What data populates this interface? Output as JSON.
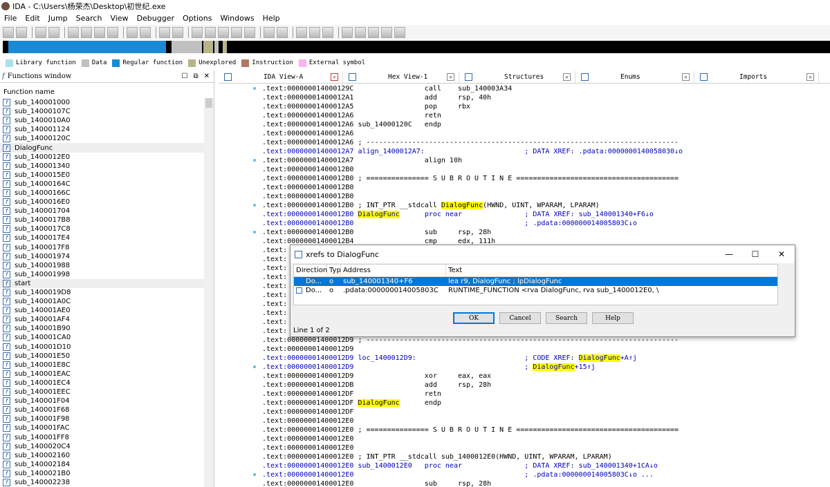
{
  "window": {
    "title": "IDA - C:\\Users\\杨荣杰\\Desktop\\初世纪.exe"
  },
  "menu": [
    "File",
    "Edit",
    "Jump",
    "Search",
    "View",
    "Debugger",
    "Options",
    "Windows",
    "Help"
  ],
  "legend": [
    {
      "label": "Library function",
      "color": "#aee0ec"
    },
    {
      "label": "Data",
      "color": "#c0c0c0"
    },
    {
      "label": "Regular function",
      "color": "#1a8ad6"
    },
    {
      "label": "Unexplored",
      "color": "#b8b48a"
    },
    {
      "label": "Instruction",
      "color": "#b07860"
    },
    {
      "label": "External symbol",
      "color": "#ffb0f0"
    }
  ],
  "functions_window": {
    "title": "Functions window",
    "column": "Function name",
    "items": [
      "sub_140001000",
      "sub_14000107C",
      "sub_1400010A0",
      "sub_140001124",
      "sub_14000120C",
      "DialogFunc",
      "sub_1400012E0",
      "sub_140001340",
      "sub_1400015E0",
      "sub_14000164C",
      "sub_14000166C",
      "sub_1400016E0",
      "sub_140001704",
      "sub_1400017B8",
      "sub_1400017C8",
      "sub_1400017E4",
      "sub_1400017F8",
      "sub_140001974",
      "sub_140001988",
      "sub_140001998",
      "start",
      "sub_1400019D8",
      "sub_140001A0C",
      "sub_140001AE0",
      "sub_140001AF4",
      "sub_140001B90",
      "sub_140001CA0",
      "sub_140001D10",
      "sub_140001E50",
      "sub_140001E8C",
      "sub_140001EAC",
      "sub_140001EC4",
      "sub_140001EEC",
      "sub_140001F04",
      "sub_140001F68",
      "sub_140001F98",
      "sub_140001FAC",
      "sub_140001FF8",
      "sub_1400020C4",
      "sub_140002160",
      "sub_140002184",
      "sub_1400021B0",
      "sub_140002238"
    ]
  },
  "tabs": [
    "IDA View-A",
    "Hex View-1",
    "Structures",
    "Enums",
    "Imports"
  ],
  "code_lines": [
    ".text:000000014000129C                 call    sub_140003A34",
    ".text:00000001400012A1                 add     rsp, 40h",
    ".text:00000001400012A5                 pop     rbx",
    ".text:00000001400012A6                 retn",
    ".text:00000001400012A6 sub_14000120C   endp",
    ".text:00000001400012A6",
    ".text:00000001400012A6 ; ---------------------------------------------------------------------------",
    ".text:00000001400012A7 align_1400012A7:                        ; DATA XREF: .pdata:0000000140058030↓o",
    ".text:00000001400012A7                 align 10h",
    ".text:00000001400012B0",
    ".text:00000001400012B0 ; =============== S U B R O U T I N E =======================================",
    ".text:00000001400012B0",
    ".text:00000001400012B0",
    ".text:00000001400012B0 ; INT_PTR __stdcall DialogFunc(HWND, UINT, WPARAM, LPARAM)",
    ".text:00000001400012B0 DialogFunc      proc near               ; DATA XREF: sub_140001340+F6↓o",
    ".text:00000001400012B0                                         ; .pdata:000000014005803C↓o",
    ".text:00000001400012B0                 sub     rsp, 28h",
    ".text:00000001400012B4                 cmp     edx, 111h",
    ".text:",
    ".text:",
    ".text:",
    ".text:",
    ".text:",
    ".text:",
    ".text:",
    ".text:",
    ".text:",
    ".text:",
    ".text:00000001400012D9 ; ---------------------------------------------------------------------------",
    ".text:00000001400012D9",
    ".text:00000001400012D9 loc_1400012D9:                          ; CODE XREF: DialogFunc+A↑j",
    ".text:00000001400012D9                                         ; DialogFunc+15↑j",
    ".text:00000001400012D9                 xor     eax, eax",
    ".text:00000001400012DB                 add     rsp, 28h",
    ".text:00000001400012DF                 retn",
    ".text:00000001400012DF DialogFunc      endp",
    ".text:00000001400012DF",
    ".text:00000001400012E0",
    ".text:00000001400012E0 ; =============== S U B R O U T I N E =======================================",
    ".text:00000001400012E0",
    ".text:00000001400012E0",
    ".text:00000001400012E0 ; INT_PTR __stdcall sub_1400012E0(HWND, UINT, WPARAM, LPARAM)",
    ".text:00000001400012E0 sub_1400012E0   proc near               ; DATA XREF: sub_140001340+1CA↓o",
    ".text:00000001400012E0                                         ; .pdata:000000014005803C↓o ...",
    ".text:00000001400012E0                 sub     rsp, 28h"
  ],
  "xrefs_dialog": {
    "title": "xrefs to DialogFunc",
    "columns": [
      "Direction",
      "Typ",
      "Address",
      "Text"
    ],
    "rows": [
      {
        "direction": "Do...",
        "type": "o",
        "address": "sub_140001340+F6",
        "text": "lea     r9, DialogFunc ; lpDialogFunc"
      },
      {
        "direction": "Do...",
        "type": "o",
        "address": ".pdata:000000014005803C",
        "text": "RUNTIME_FUNCTION <rva DialogFunc, rva sub_1400012E0, \\"
      }
    ],
    "buttons": {
      "ok": "OK",
      "cancel": "Cancel",
      "search": "Search",
      "help": "Help"
    },
    "status": "Line 1 of 2"
  }
}
